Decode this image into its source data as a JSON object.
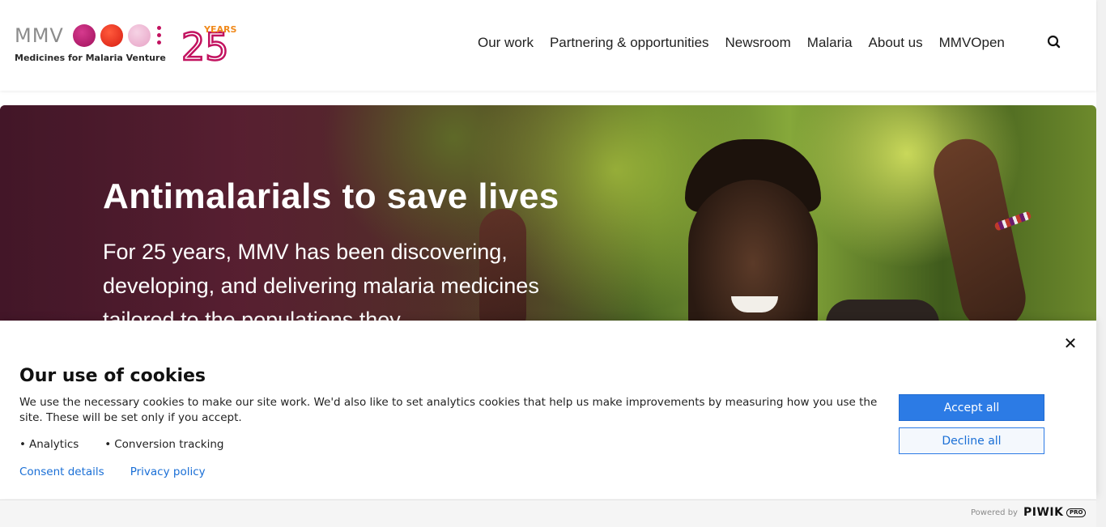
{
  "header": {
    "logo_text": "MMV",
    "logo_subtitle": "Medicines for Malaria Venture",
    "anniversary_number": "25",
    "anniversary_label": "YEARS",
    "nav": [
      "Our work",
      "Partnering & opportunities",
      "Newsroom",
      "Malaria",
      "About us",
      "MMVOpen"
    ],
    "search_icon": "search-icon"
  },
  "hero": {
    "title": "Antimalarials to save lives",
    "text": "For 25 years, MMV has been discovering, developing, and delivering malaria medicines tailored to the populations they"
  },
  "cookie_banner": {
    "title": "Our use of cookies",
    "text": "We use the necessary cookies to make our site work. We'd also like to set analytics cookies that help us make improvements by measuring how you use the site. These will be set only if you accept.",
    "categories": [
      "Analytics",
      "Conversion tracking"
    ],
    "links": [
      "Consent details",
      "Privacy policy"
    ],
    "accept_label": "Accept all",
    "decline_label": "Decline all",
    "close_icon": "close-icon"
  },
  "footer": {
    "powered_by": "Powered by",
    "brand": "PIWIK",
    "brand_suffix": "PRO"
  },
  "colors": {
    "accent": "#2c7be5",
    "link": "#1a6fd6",
    "brand_magenta": "#c2125f",
    "brand_red": "#d81e12",
    "brand_orange": "#f08a1c"
  }
}
